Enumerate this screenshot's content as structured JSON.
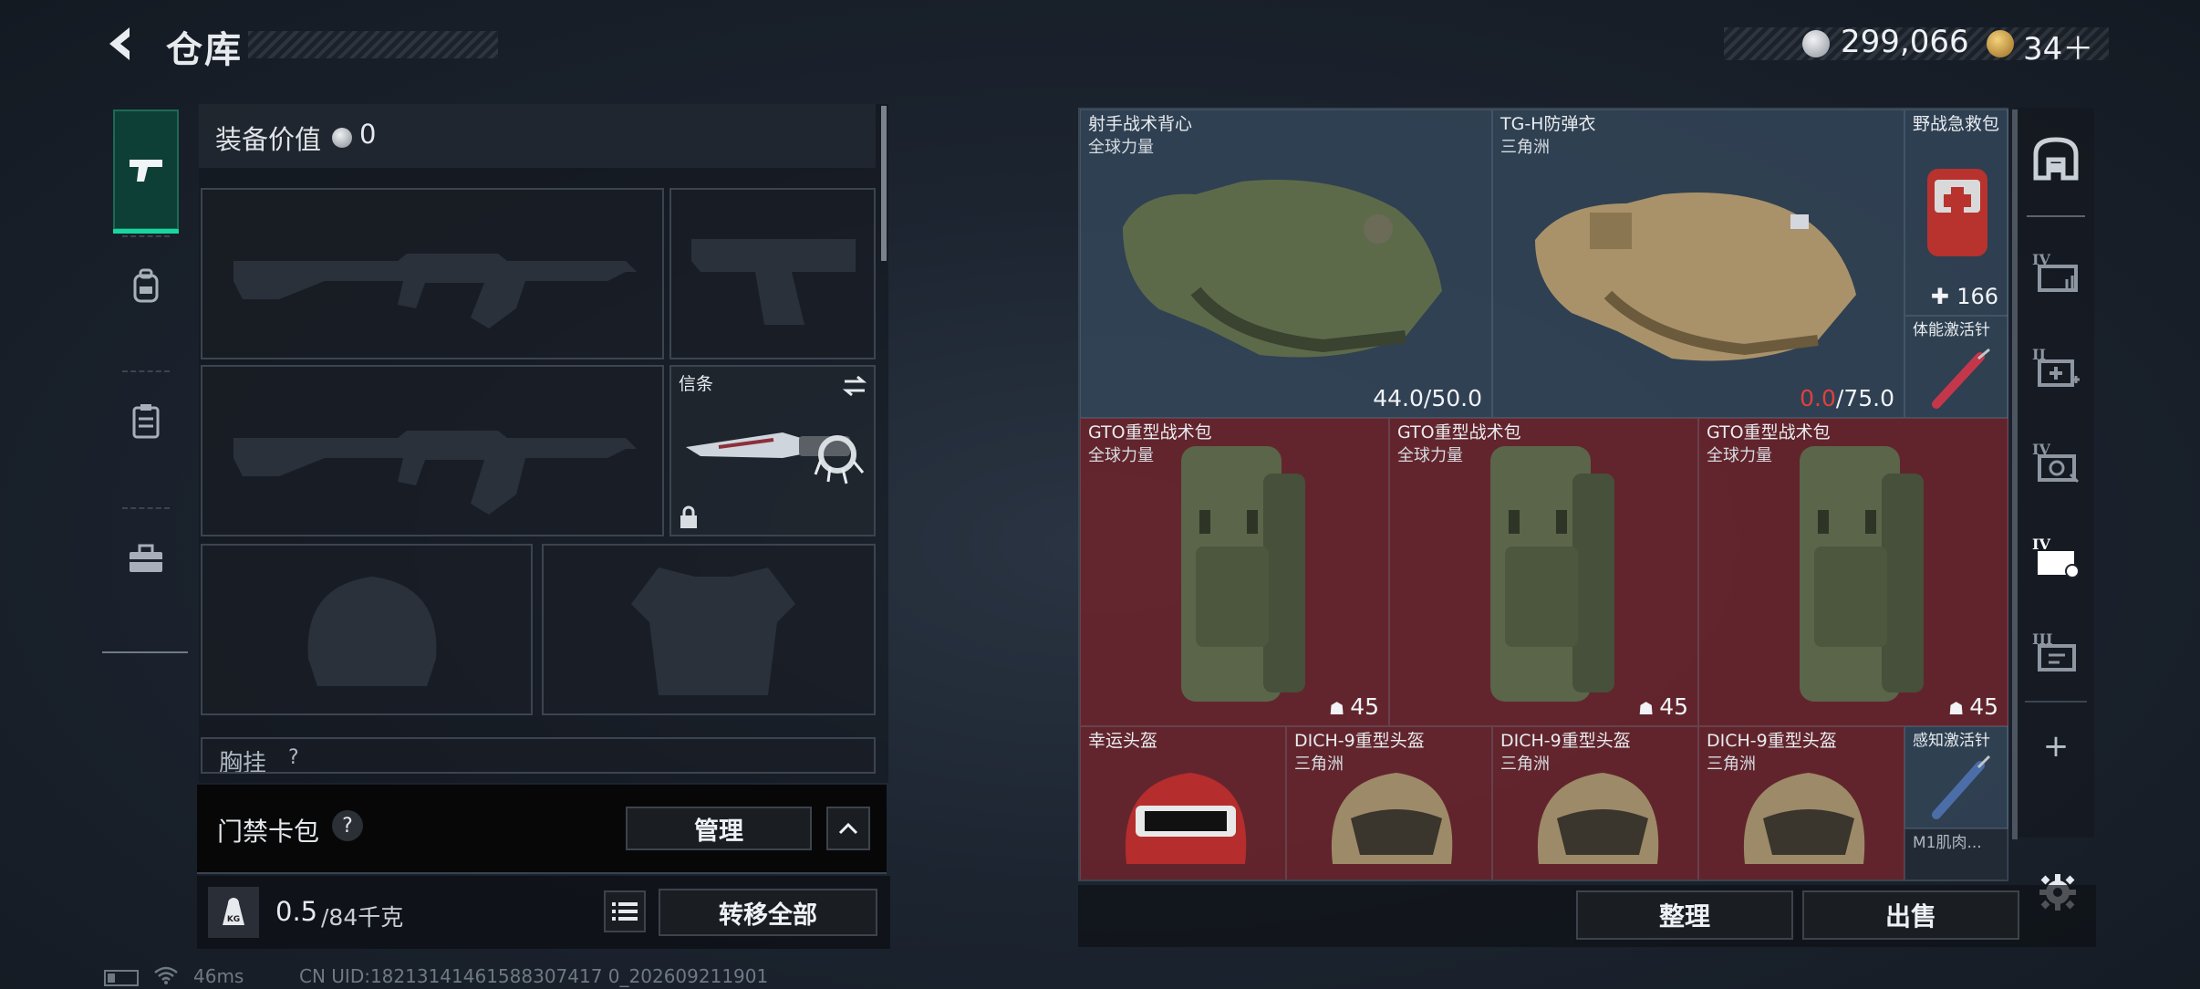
{
  "header": {
    "title": "仓库",
    "currency": [
      {
        "icon": "coin-silver-icon",
        "value": "299,066"
      },
      {
        "icon": "coin-gold-icon",
        "value": "34＋"
      }
    ]
  },
  "left_tabs": [
    {
      "icon": "pistol-icon",
      "active": true
    },
    {
      "icon": "backpack-icon",
      "active": false
    },
    {
      "icon": "clipboard-icon",
      "active": false
    },
    {
      "icon": "toolbox-icon",
      "active": false
    }
  ],
  "equipment": {
    "value_label": "装备价值",
    "value": "0",
    "knife_slot_label": "信条",
    "chest_label": "胸挂",
    "chest_value": "?"
  },
  "access_card": {
    "label": "门禁卡包",
    "help": "?",
    "manage": "管理"
  },
  "weight": {
    "current": "0.5",
    "max": "/84千克",
    "transfer_all": "转移全部"
  },
  "stash": {
    "items": [
      {
        "name": "射手战术背心",
        "sub": "全球力量",
        "value_main": "44.0",
        "value_rest": "/50.0",
        "bg": "blue"
      },
      {
        "name": "TG-H防弹衣",
        "sub": "三角洲",
        "value_main": "0.0",
        "value_rest": "/75.0",
        "bg": "blue"
      },
      {
        "name": "野战急救包",
        "sub": "",
        "value": "166",
        "bg": "blue"
      },
      {
        "name": "体能激活针",
        "sub": "",
        "bg": "blue"
      },
      {
        "name": "GTO重型战术包",
        "sub": "全球力量",
        "value": "45",
        "bg": "red"
      },
      {
        "name": "GTO重型战术包",
        "sub": "全球力量",
        "value": "45",
        "bg": "red"
      },
      {
        "name": "GTO重型战术包",
        "sub": "全球力量",
        "value": "45",
        "bg": "red"
      },
      {
        "name": "幸运头盔",
        "sub": "",
        "bg": "red"
      },
      {
        "name": "DICH-9重型头盔",
        "sub": "三角洲",
        "bg": "red"
      },
      {
        "name": "DICH-9重型头盔",
        "sub": "三角洲",
        "bg": "red"
      },
      {
        "name": "DICH-9重型头盔",
        "sub": "三角洲",
        "bg": "red"
      },
      {
        "name": "感知激活针",
        "sub": "",
        "bg": "blue"
      },
      {
        "name": "M1肌肉...",
        "sub": "",
        "bg": "dark"
      }
    ]
  },
  "right_tabs": [
    {
      "icon": "safe-icon"
    },
    {
      "icon": "stash-tier-iv-a-icon",
      "label": "IV"
    },
    {
      "icon": "stash-tier-ii-medkit-icon",
      "label": "II"
    },
    {
      "icon": "stash-tier-iv-camera-icon",
      "label": "IV"
    },
    {
      "icon": "stash-tier-iv-active-icon",
      "label": "IV"
    },
    {
      "icon": "stash-tier-iii-icon",
      "label": "III"
    },
    {
      "icon": "add-icon",
      "label": "+"
    }
  ],
  "actions": {
    "sort": "整理",
    "sell": "出售"
  },
  "status": {
    "ping": "46ms",
    "uid": "CN UID:18213141461588307417 0_202609211901"
  },
  "colors": {
    "accent_green": "#18d6a0",
    "stash_blue": "#46607a",
    "stash_red": "#782830",
    "durability_red": "#e0403e"
  }
}
